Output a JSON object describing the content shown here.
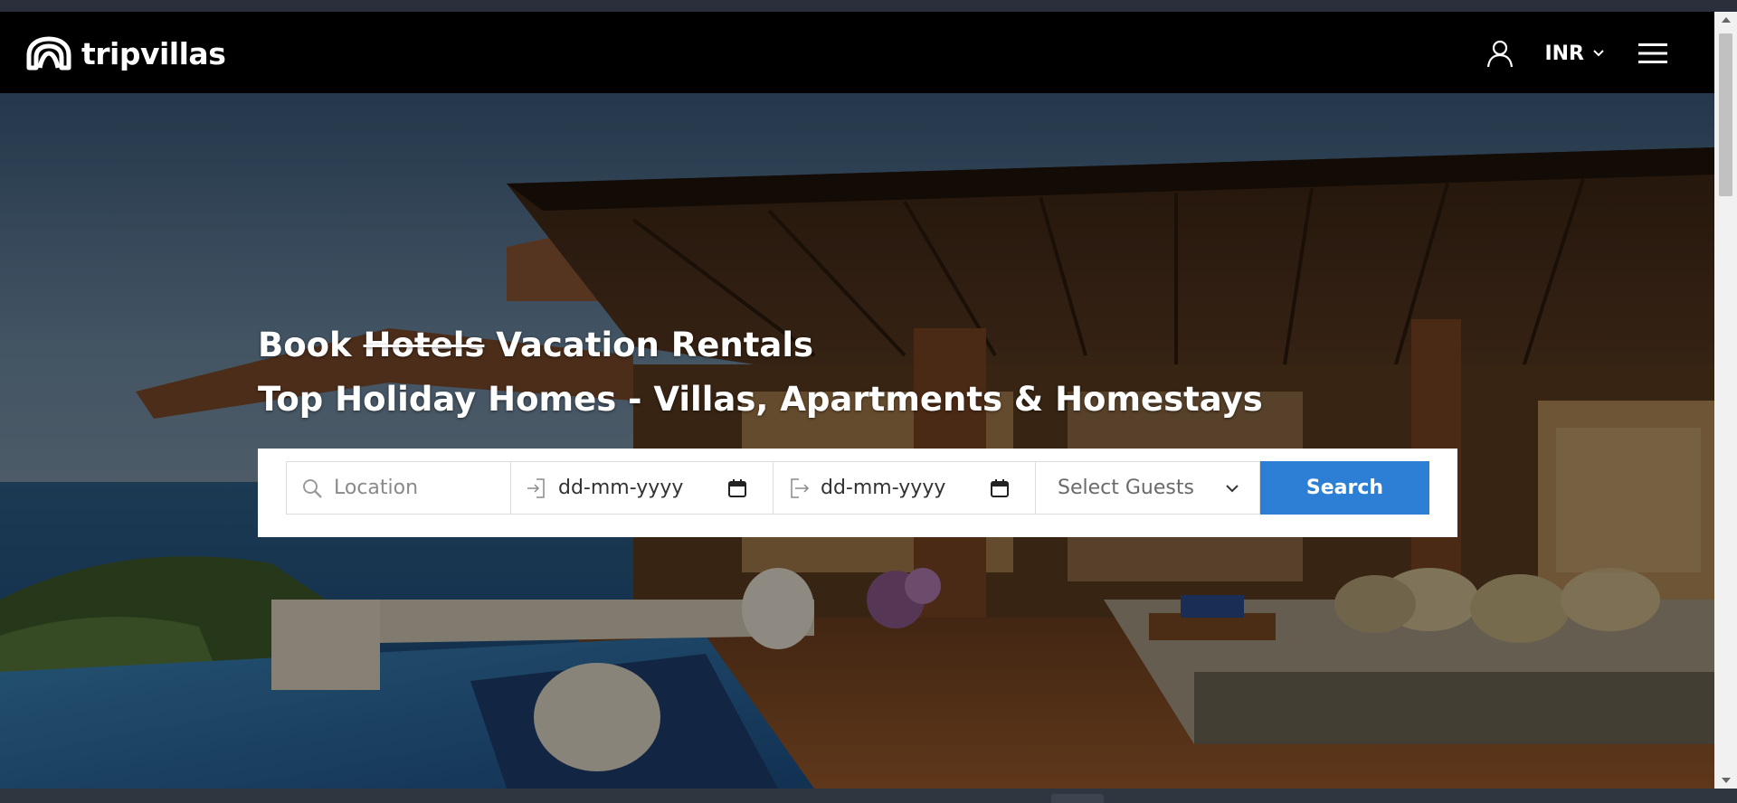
{
  "brand": {
    "name": "tripvillas",
    "logo_icon": "arch-logo-icon"
  },
  "nav": {
    "user_icon": "user-icon",
    "currency": "INR",
    "menu_icon": "hamburger-menu-icon"
  },
  "hero": {
    "line1_prefix": "Book ",
    "line1_struck": "Hotels",
    "line1_suffix": " Vacation Rentals",
    "line2": "Top Holiday Homes - Villas, Apartments & Homestays"
  },
  "search": {
    "location_placeholder": "Location",
    "checkin_value": "dd-mm-yyyy",
    "checkout_value": "dd-mm-yyyy",
    "guests_label": "Select Guests",
    "button_label": "Search"
  },
  "colors": {
    "navbar_bg": "#000000",
    "search_button": "#2c7fd4"
  }
}
